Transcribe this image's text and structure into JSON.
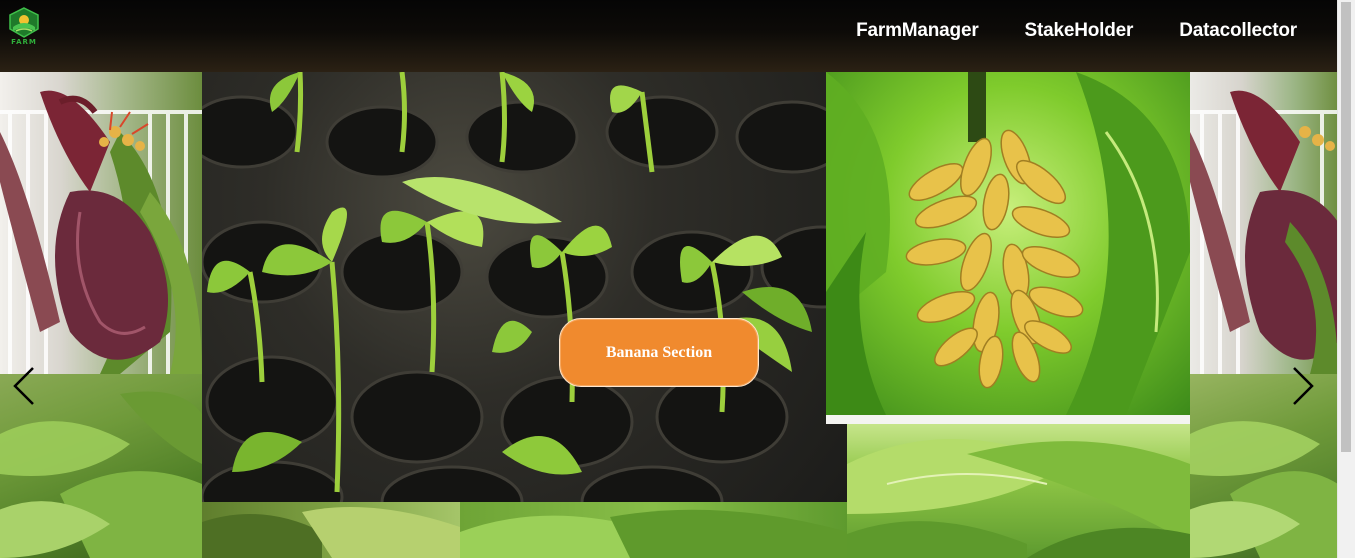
{
  "logo": {
    "text": "FARM",
    "icon": "farm-logo-icon"
  },
  "nav": {
    "items": [
      {
        "label": "FarmManager"
      },
      {
        "label": "StakeHolder"
      },
      {
        "label": "Datacollector"
      }
    ]
  },
  "carousel": {
    "button_label": "Banana Section",
    "prev_icon": "chevron-left-icon",
    "next_icon": "chevron-right-icon"
  },
  "colors": {
    "accent": "#f08a2e",
    "nav_text": "#ffffff",
    "logo_green": "#2fae3a"
  }
}
